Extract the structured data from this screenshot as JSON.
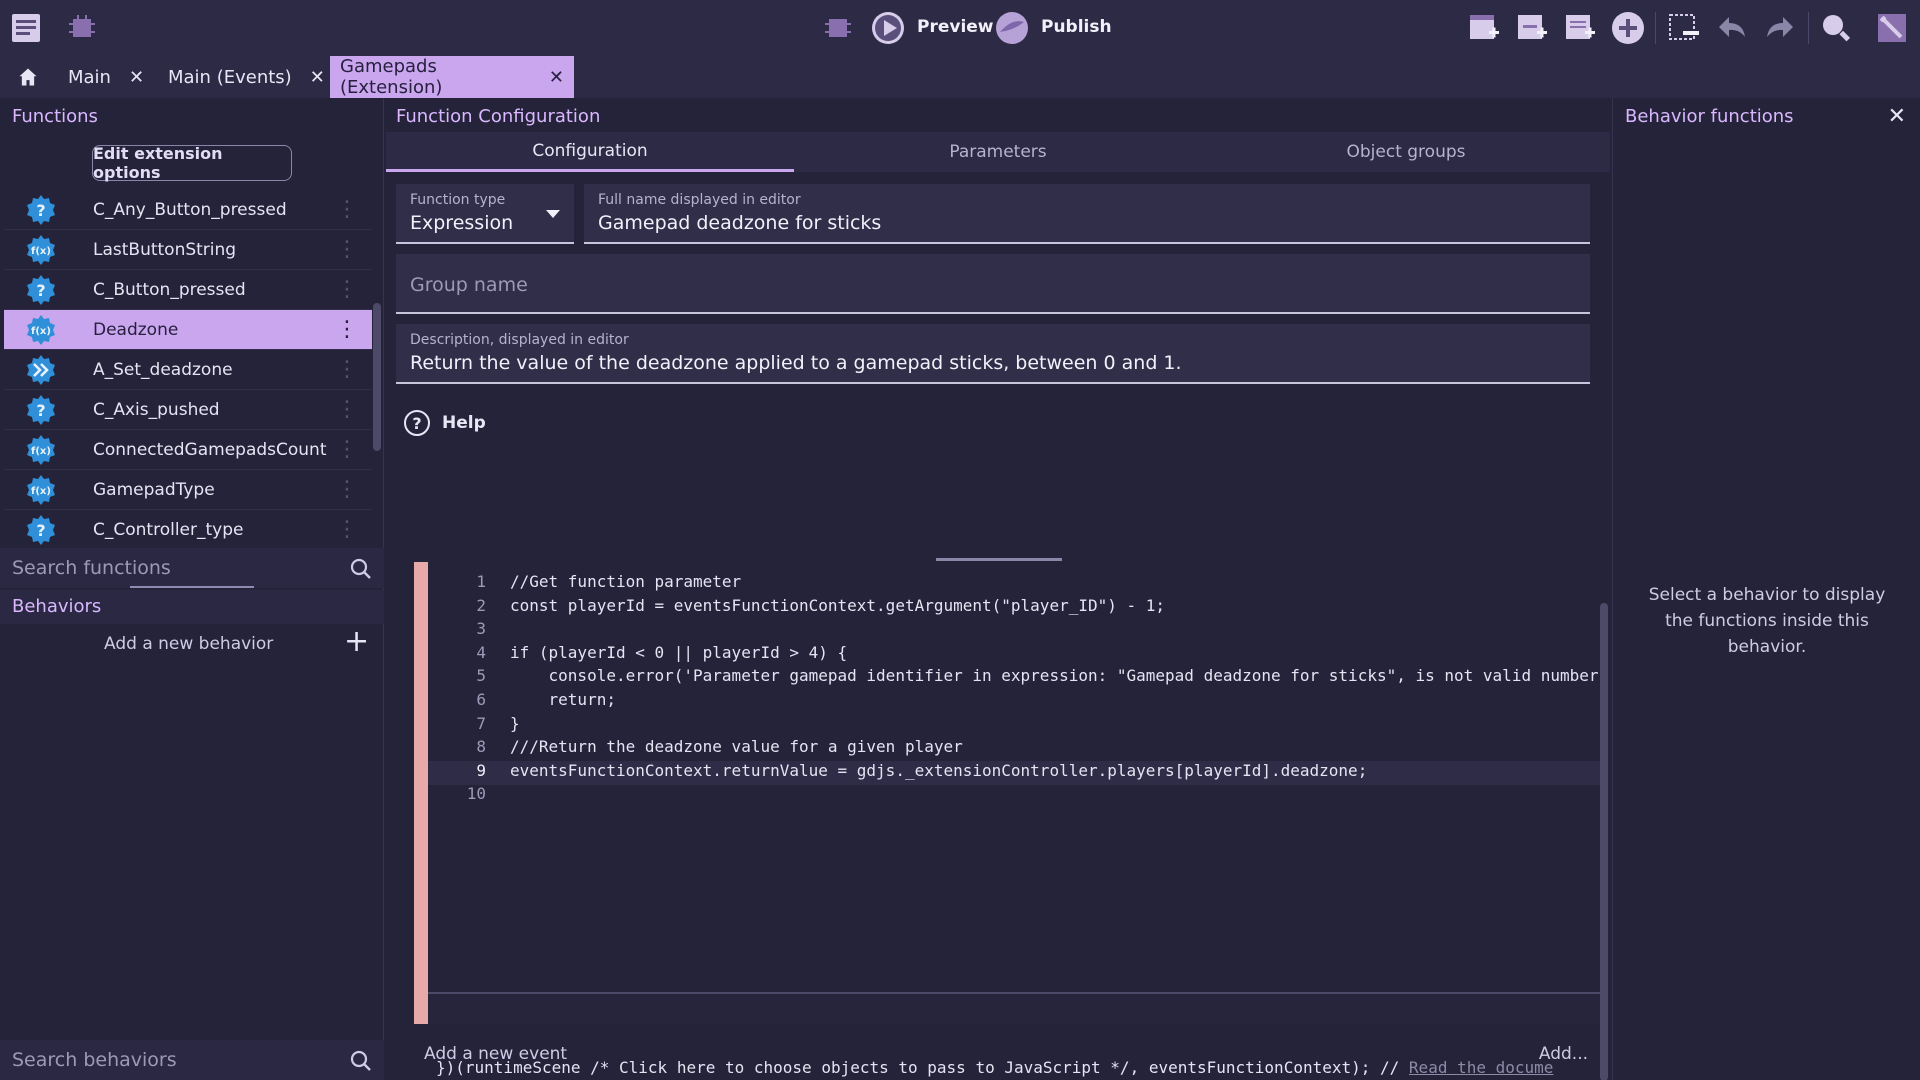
{
  "toolbar": {
    "preview_label": "Preview",
    "publish_label": "Publish"
  },
  "tabs": [
    {
      "label": "Main"
    },
    {
      "label": "Main (Events)"
    },
    {
      "label": "Gamepads (Extension)"
    }
  ],
  "left": {
    "functions_title": "Functions",
    "edit_button": "Edit extension options",
    "functions": [
      {
        "label": "C_Any_Button_pressed",
        "icon": "condition-icon"
      },
      {
        "label": "LastButtonString",
        "icon": "expression-icon"
      },
      {
        "label": "C_Button_pressed",
        "icon": "condition-icon"
      },
      {
        "label": "Deadzone",
        "icon": "expression-icon",
        "selected": true
      },
      {
        "label": "A_Set_deadzone",
        "icon": "action-icon"
      },
      {
        "label": "C_Axis_pushed",
        "icon": "condition-icon"
      },
      {
        "label": "ConnectedGamepadsCount",
        "icon": "expression-icon"
      },
      {
        "label": "GamepadType",
        "icon": "expression-icon"
      },
      {
        "label": "C_Controller_type",
        "icon": "condition-icon"
      }
    ],
    "search_functions_placeholder": "Search functions",
    "behaviors_title": "Behaviors",
    "add_behavior": "Add a new behavior",
    "search_behaviors_placeholder": "Search behaviors"
  },
  "middle": {
    "title": "Function Configuration",
    "tabs": [
      "Configuration",
      "Parameters",
      "Object groups"
    ],
    "function_type_label": "Function type",
    "function_type_value": "Expression",
    "full_name_label": "Full name displayed in editor",
    "full_name_value": "Gamepad deadzone for sticks",
    "group_name_placeholder": "Group name",
    "description_label": "Description, displayed in editor",
    "description_value": "Return the value of the deadzone applied to a gamepad sticks, between 0 and 1.",
    "help_label": "Help",
    "code_lines": [
      {
        "n": "1",
        "text": "//Get function parameter"
      },
      {
        "n": "2",
        "text": "const playerId = eventsFunctionContext.getArgument(\"player_ID\") - 1;"
      },
      {
        "n": "3",
        "text": ""
      },
      {
        "n": "4",
        "text": "if (playerId < 0 || playerId > 4) {"
      },
      {
        "n": "5",
        "text": "    console.error('Parameter gamepad identifier in expression: \"Gamepad deadzone for sticks\", is not valid number,"
      },
      {
        "n": "6",
        "text": "    return;"
      },
      {
        "n": "7",
        "text": "}"
      },
      {
        "n": "8",
        "text": "///Return the deadzone value for a given player"
      },
      {
        "n": "9",
        "text": "eventsFunctionContext.returnValue = gdjs._extensionController.players[playerId].deadzone;"
      },
      {
        "n": "10",
        "text": ""
      }
    ],
    "code_tail_prefix": "})(runtimeScene /* Click here to choose objects to pass to JavaScript */, eventsFunctionContext); // ",
    "code_tail_link": "Read the docume",
    "add_event": "Add a new event",
    "add_more": "Add..."
  },
  "right": {
    "title": "Behavior functions",
    "message": "Select a behavior to display the functions inside this behavior."
  },
  "colors": {
    "accent": "#c9a6ee",
    "panel_title": "#d9b8ff",
    "background": "#25233a",
    "icon_blue": "#2f8fd8"
  }
}
